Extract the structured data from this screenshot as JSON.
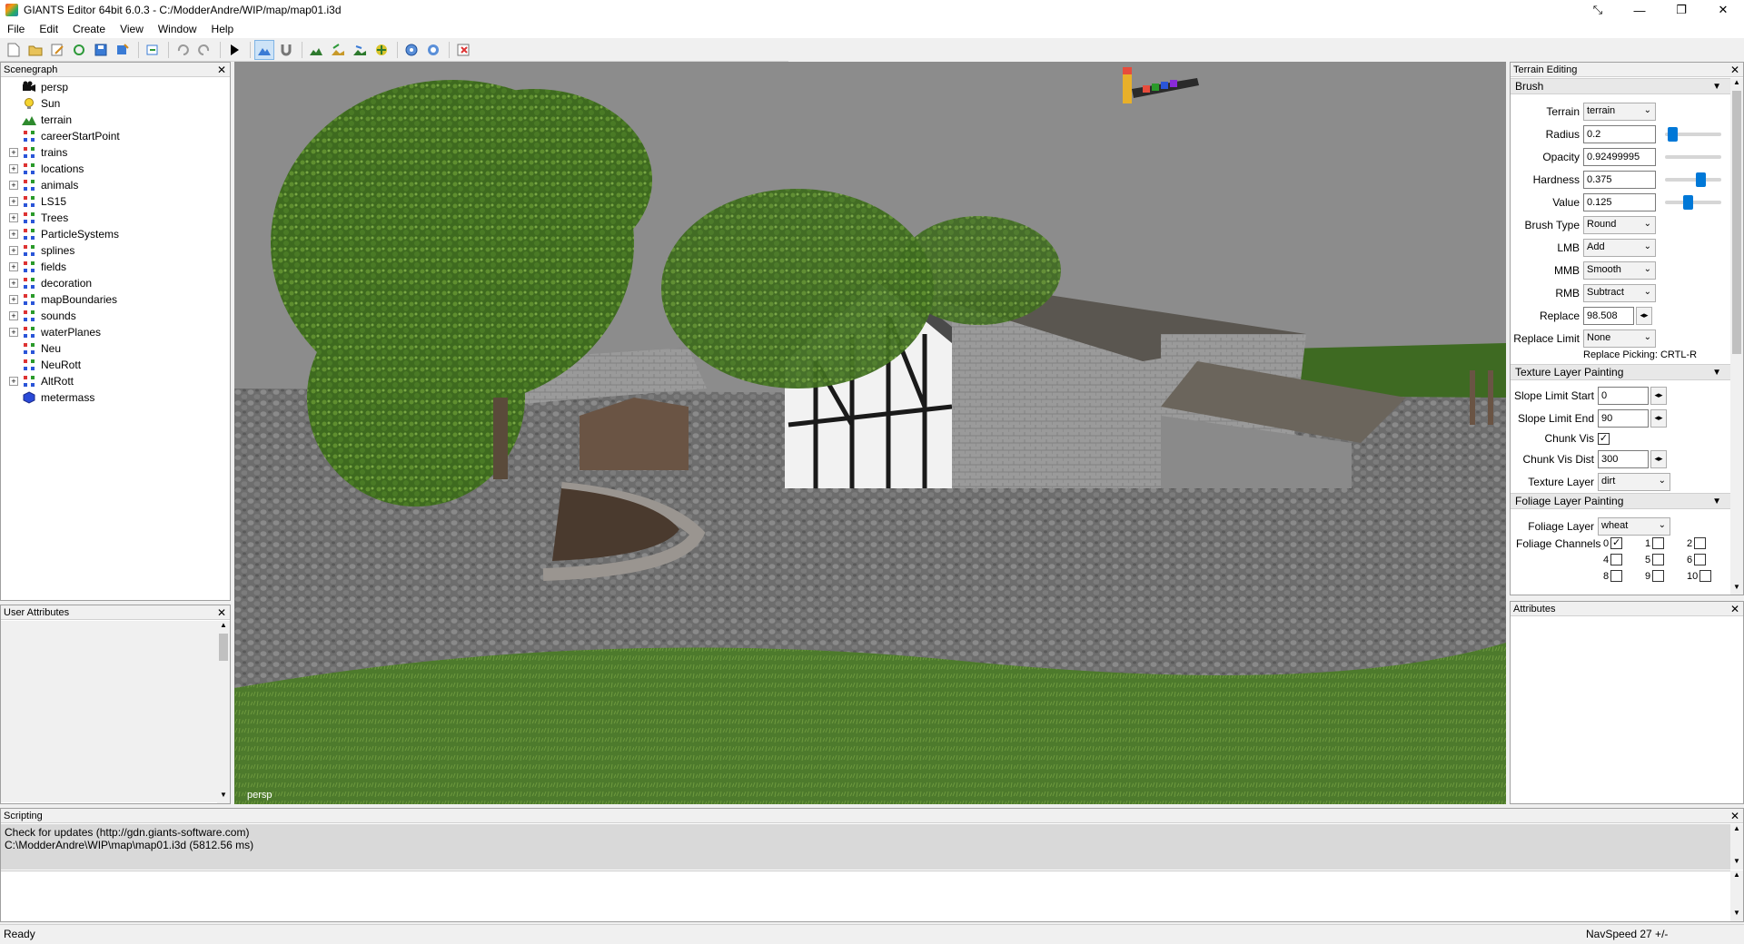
{
  "window": {
    "title": "GIANTS Editor 64bit 6.0.3 - C:/ModderAndre/WIP/map/map01.i3d"
  },
  "menu": [
    "File",
    "Edit",
    "Create",
    "View",
    "Window",
    "Help"
  ],
  "scenegraph": {
    "title": "Scenegraph",
    "items": [
      {
        "label": "persp",
        "icon": "camera-icon",
        "expandable": false
      },
      {
        "label": "Sun",
        "icon": "light-icon",
        "expandable": false
      },
      {
        "label": "terrain",
        "icon": "terrain-icon",
        "expandable": false
      },
      {
        "label": "careerStartPoint",
        "icon": "transform-group-icon",
        "expandable": false
      },
      {
        "label": "trains",
        "icon": "transform-group-icon",
        "expandable": true
      },
      {
        "label": "locations",
        "icon": "transform-group-icon",
        "expandable": true
      },
      {
        "label": "animals",
        "icon": "transform-group-icon",
        "expandable": true
      },
      {
        "label": "LS15",
        "icon": "transform-group-icon",
        "expandable": true
      },
      {
        "label": "Trees",
        "icon": "transform-group-icon",
        "expandable": true
      },
      {
        "label": "ParticleSystems",
        "icon": "transform-group-icon",
        "expandable": true
      },
      {
        "label": "splines",
        "icon": "transform-group-icon",
        "expandable": true
      },
      {
        "label": "fields",
        "icon": "transform-group-icon",
        "expandable": true
      },
      {
        "label": "decoration",
        "icon": "transform-group-icon",
        "expandable": true
      },
      {
        "label": "mapBoundaries",
        "icon": "transform-group-icon",
        "expandable": true
      },
      {
        "label": "sounds",
        "icon": "transform-group-icon",
        "expandable": true
      },
      {
        "label": "waterPlanes",
        "icon": "transform-group-icon",
        "expandable": true
      },
      {
        "label": "Neu",
        "icon": "transform-group-icon",
        "expandable": false
      },
      {
        "label": "NeuRott",
        "icon": "transform-group-icon",
        "expandable": false
      },
      {
        "label": "AltRott",
        "icon": "transform-group-icon",
        "expandable": true
      },
      {
        "label": "metermass",
        "icon": "mesh-cube-icon",
        "expandable": false
      }
    ]
  },
  "user_attributes": {
    "title": "User Attributes"
  },
  "viewport": {
    "label": "persp"
  },
  "terrain_editing": {
    "title": "Terrain Editing",
    "brush_section": "Brush",
    "terrain_label": "Terrain",
    "terrain_value": "terrain",
    "radius_label": "Radius",
    "radius_value": "0.2",
    "radius_slider": 0.05,
    "opacity_label": "Opacity",
    "opacity_value": "0.92499995",
    "hardness_label": "Hardness",
    "hardness_value": "0.375",
    "hardness_slider": 0.6,
    "value_label": "Value",
    "value_value": "0.125",
    "value_slider": 0.35,
    "brush_type_label": "Brush Type",
    "brush_type_value": "Round",
    "lmb_label": "LMB",
    "lmb_value": "Add",
    "mmb_label": "MMB",
    "mmb_value": "Smooth",
    "rmb_label": "RMB",
    "rmb_value": "Subtract",
    "replace_label": "Replace",
    "replace_value": "98.508",
    "replace_limit_label": "Replace Limit",
    "replace_limit_value": "None",
    "replace_picking": "Replace Picking: CRTL-R",
    "texture_section": "Texture Layer Painting",
    "slope_start_label": "Slope Limit Start",
    "slope_start_value": "0",
    "slope_end_label": "Slope Limit End",
    "slope_end_value": "90",
    "chunk_vis_label": "Chunk Vis",
    "chunk_vis_checked": true,
    "chunk_vis_dist_label": "Chunk Vis Dist",
    "chunk_vis_dist_value": "300",
    "texture_layer_label": "Texture Layer",
    "texture_layer_value": "dirt",
    "foliage_section": "Foliage Layer Painting",
    "foliage_layer_label": "Foliage Layer",
    "foliage_layer_value": "wheat",
    "foliage_channels_label": "Foliage Channels",
    "channels": [
      {
        "n": "0",
        "checked": true
      },
      {
        "n": "1",
        "checked": false
      },
      {
        "n": "2",
        "checked": false
      },
      {
        "n": "4",
        "checked": false
      },
      {
        "n": "5",
        "checked": false
      },
      {
        "n": "6",
        "checked": false
      },
      {
        "n": "8",
        "checked": false
      },
      {
        "n": "9",
        "checked": false
      },
      {
        "n": "10",
        "checked": false
      }
    ]
  },
  "attributes": {
    "title": "Attributes"
  },
  "scripting": {
    "title": "Scripting",
    "lines": [
      "Check for updates (http://gdn.giants-software.com)",
      "C:\\ModderAndre\\WIP\\map\\map01.i3d (5812.56 ms)"
    ]
  },
  "status": {
    "left": "Ready",
    "right": "NavSpeed 27 +/-"
  },
  "colors": {
    "accent": "#0078d7",
    "grass": "#4a7a2a",
    "cobble": "#6b6b6b",
    "sky": "#8c8c8c"
  }
}
